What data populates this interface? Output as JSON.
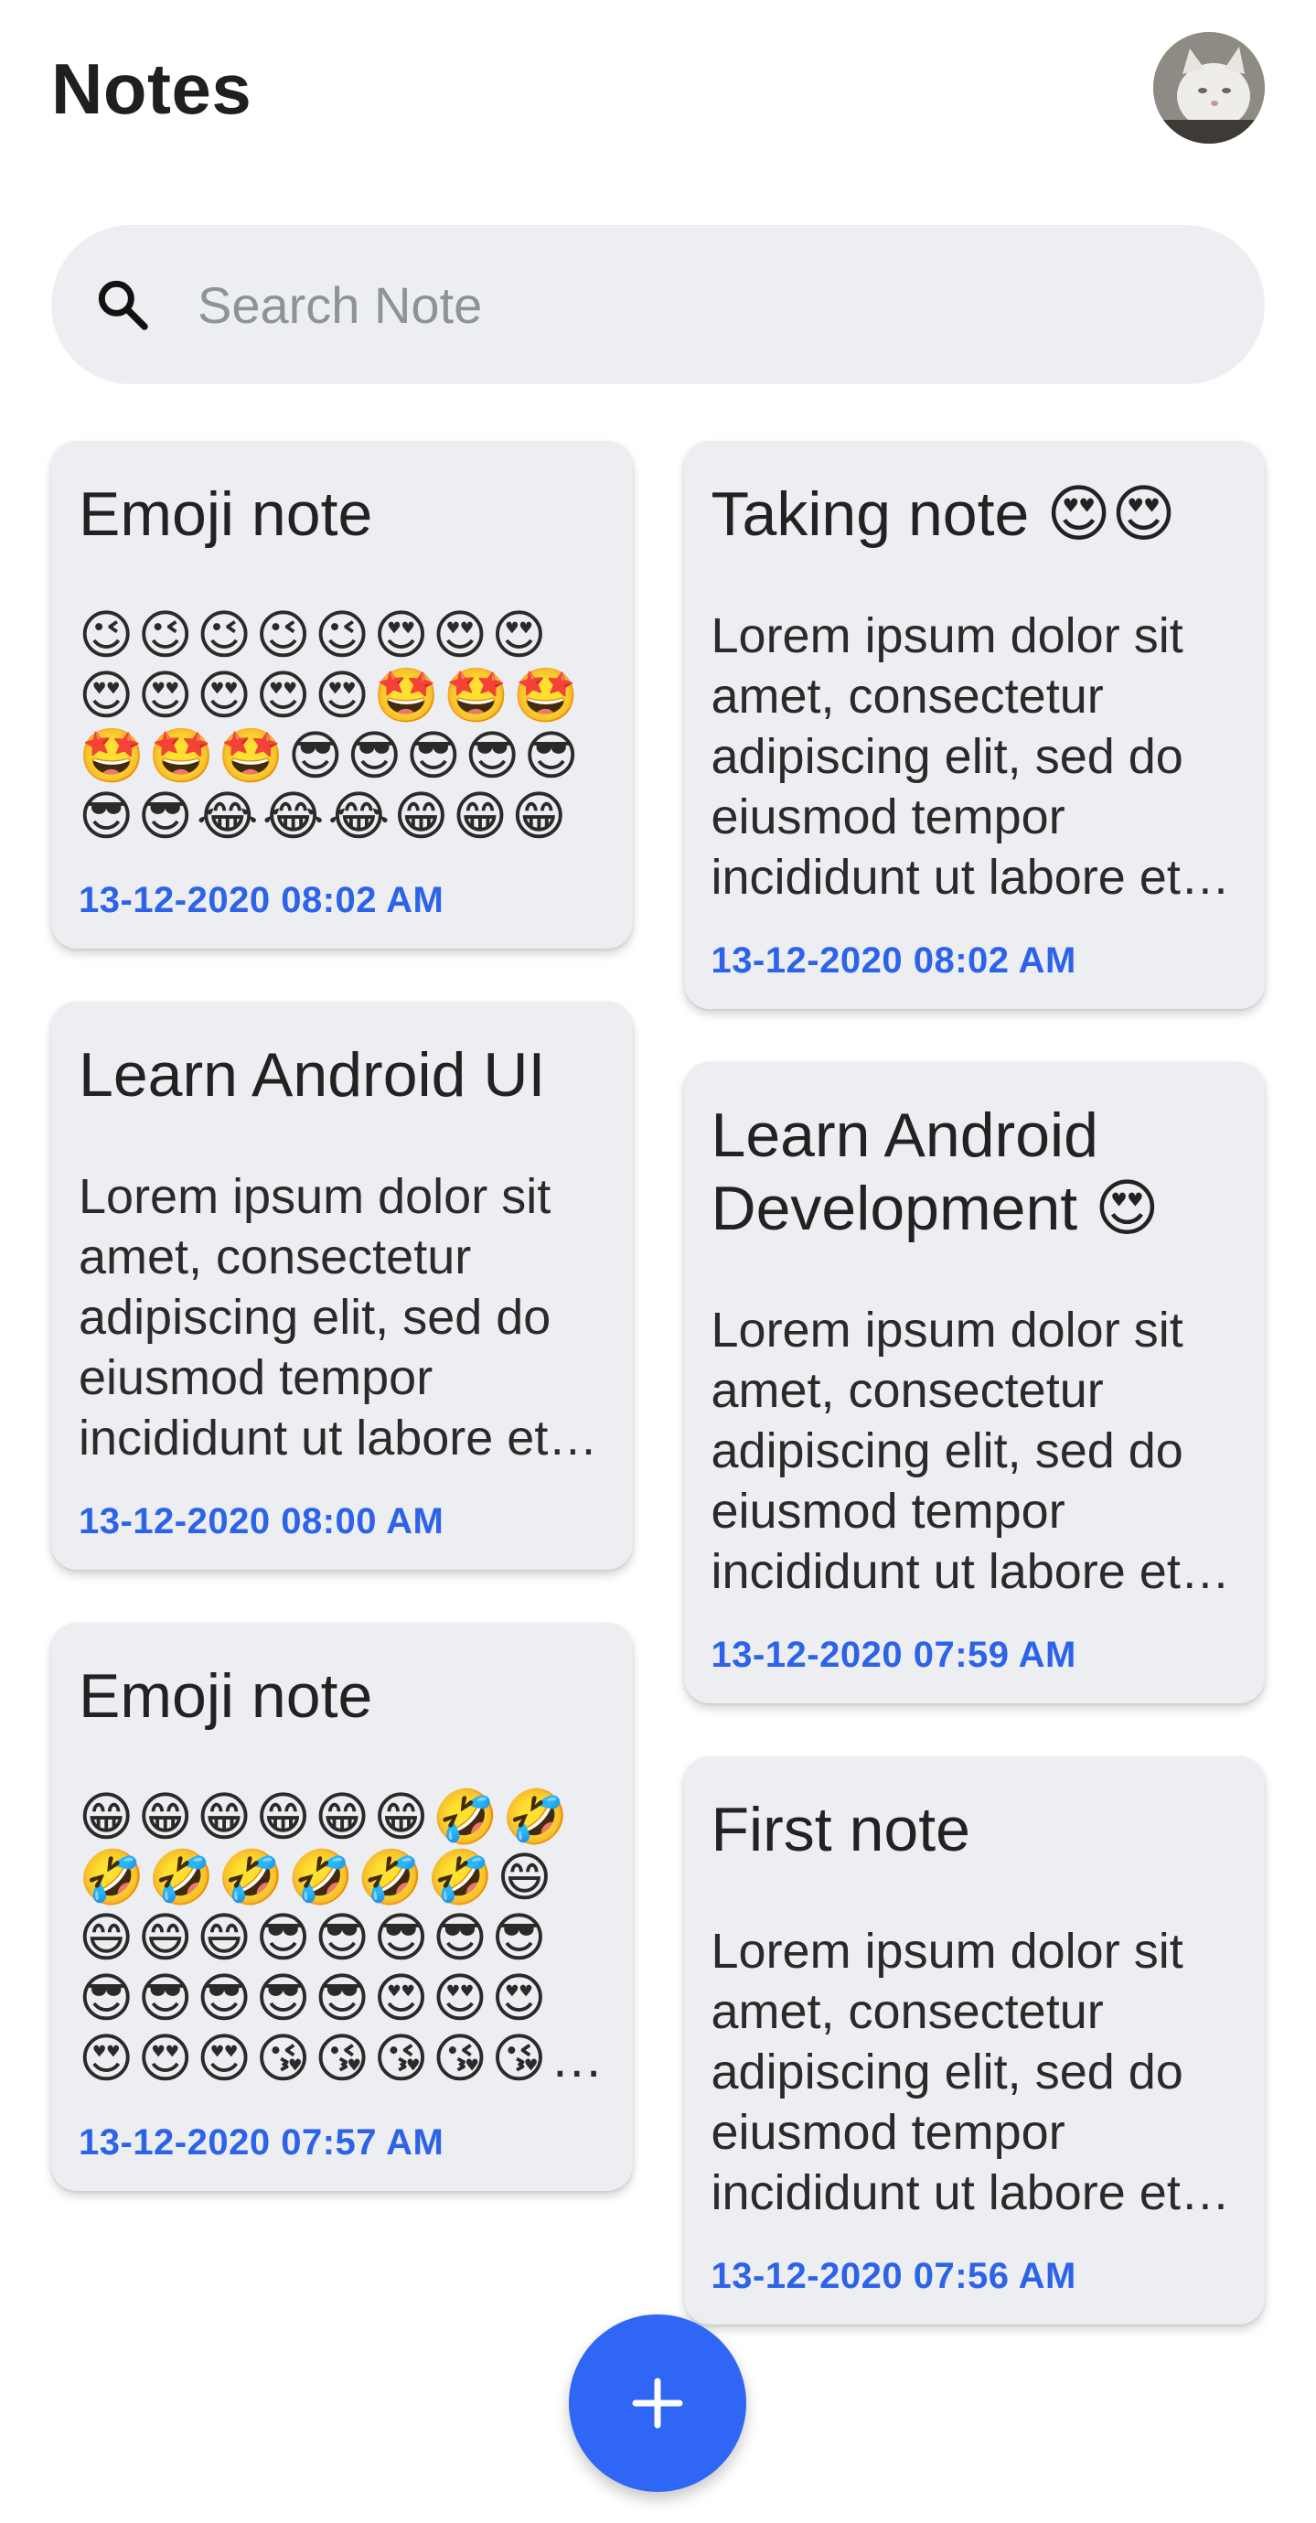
{
  "header": {
    "title": "Notes",
    "avatar_icon": "cat-avatar-icon"
  },
  "search": {
    "placeholder": "Search Note",
    "value": "",
    "icon": "search-icon"
  },
  "notes_left": [
    {
      "title": "Emoji note",
      "body": "😉😉😉😉😉😍😍😍😍😍😍😍😍🤩🤩🤩🤩🤩🤩😎😎😎😎😎😎😎😂😂😂😁😁😁",
      "date": "13-12-2020 08:02 AM",
      "emoji": true
    },
    {
      "title": "Learn Android UI",
      "body": "Lorem ipsum dolor sit amet, consectetur adipiscing elit, sed do eiusmod tempor incididunt ut labore et dolore magna aliqua.",
      "date": "13-12-2020 08:00 AM",
      "emoji": false
    },
    {
      "title": "Emoji note",
      "body": "😁😁😁😁😁😁🤣🤣🤣🤣🤣🤣🤣🤣😄😄😄😄😎😎😎😎😎😎😎😎😎😎😍😍😍😍😍😍😘😘😘😘😘😘😘",
      "date": "13-12-2020 07:57 AM",
      "emoji": true
    }
  ],
  "notes_right": [
    {
      "title": "Taking note 😍😍",
      "body": "Lorem ipsum dolor sit amet, consectetur adipiscing elit, sed do eiusmod tempor incididunt ut labore et dolore magna aliqua.",
      "date": "13-12-2020 08:02 AM",
      "emoji": false
    },
    {
      "title": "Learn Android Development 😍",
      "body": "Lorem ipsum dolor sit amet, consectetur adipiscing elit, sed do eiusmod tempor incididunt ut labore et dolore magna aliqua.",
      "date": "13-12-2020 07:59 AM",
      "emoji": false
    },
    {
      "title": "First note",
      "body": "Lorem ipsum dolor sit amet, consectetur adipiscing elit, sed do eiusmod tempor incididunt ut labore et dolore magna aliqua.",
      "date": "13-12-2020 07:56 AM",
      "emoji": false
    }
  ],
  "fab": {
    "icon": "plus-icon"
  },
  "colors": {
    "accent": "#2f66f6",
    "date": "#2d63e8",
    "card": "#eceef1"
  }
}
